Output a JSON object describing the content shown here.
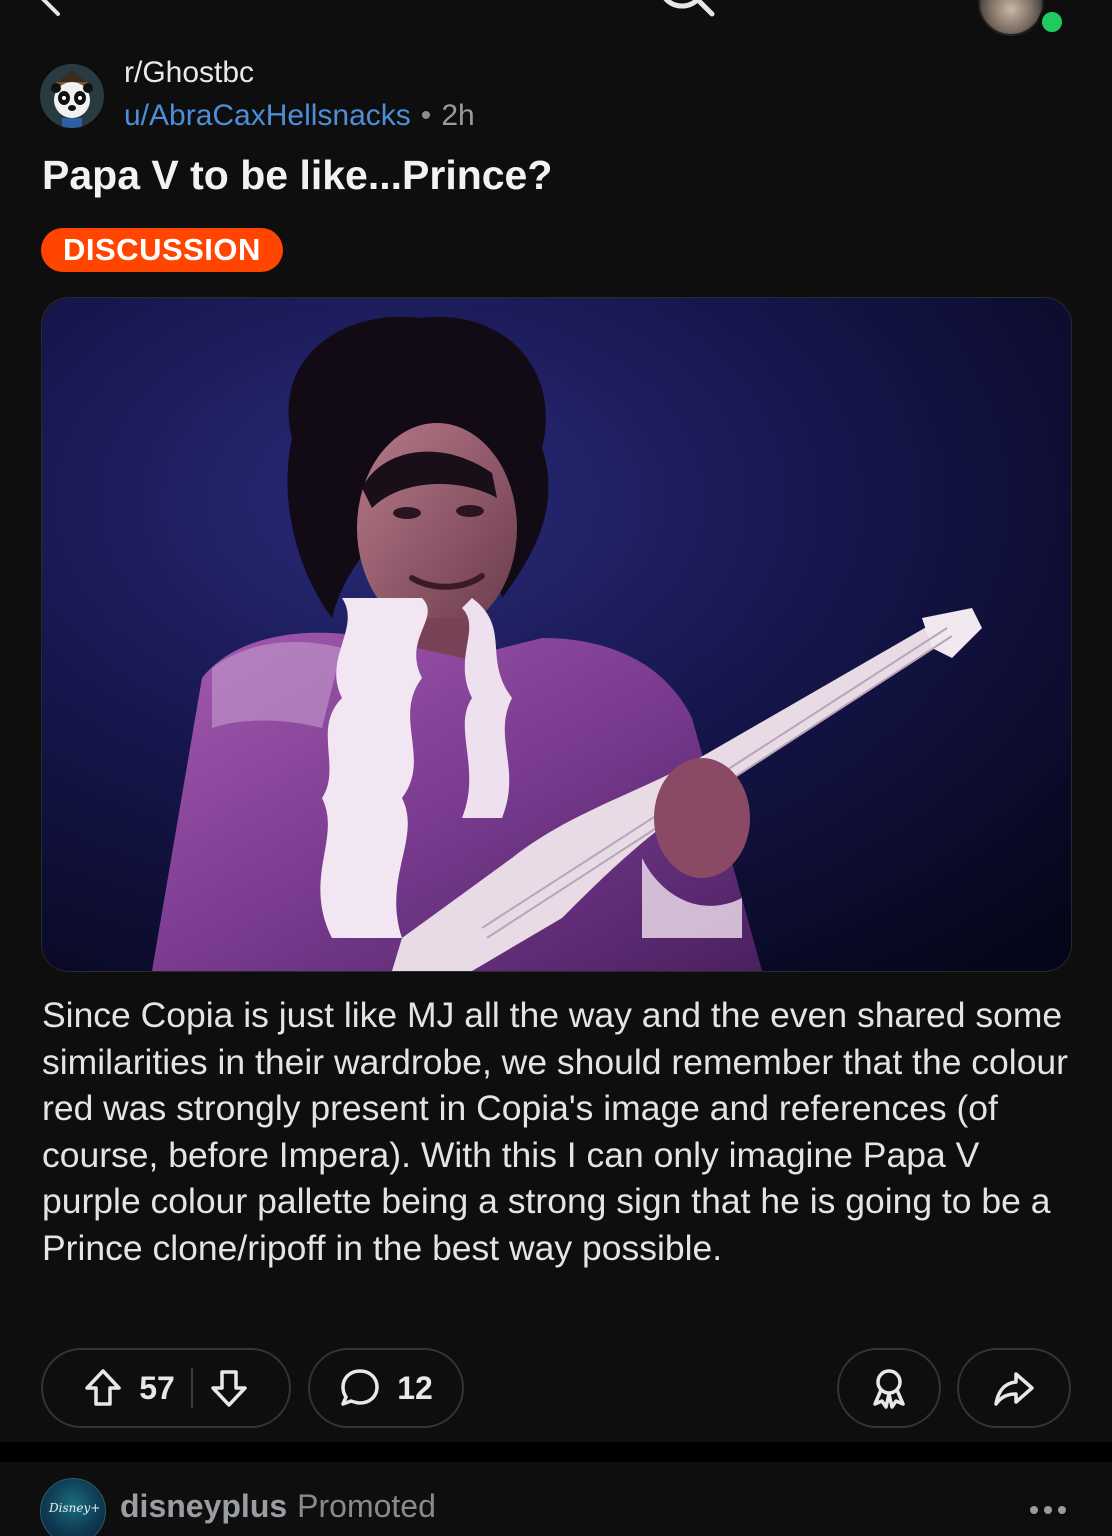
{
  "post": {
    "subreddit": "r/Ghostbc",
    "author": "u/AbraCaxHellsnacks",
    "separator": "•",
    "age": "2h",
    "title": "Papa V to be like...Prince?",
    "flair": "DISCUSSION",
    "body": "Since Copia is just like MJ all the way and the even shared some similarities in their wardrobe, we should remember that the colour red was strongly present in Copia's image and references (of course, before Impera). With this I can only imagine Papa V purple colour pallette being a strong sign that he is going to be a Prince clone/ripoff in the best way possible.",
    "upvotes": "57",
    "comments": "12"
  },
  "promoted": {
    "name": "disneyplus",
    "tag": "Promoted",
    "avatar_text": "Disney+"
  },
  "colors": {
    "flair": "#ff4500",
    "username": "#4c8fd8",
    "online": "#1fcc5f"
  },
  "icons": {
    "back": "chevron-left-icon",
    "search": "search-icon",
    "chat": "chat-icon",
    "upvote": "upvote-arrow-icon",
    "downvote": "downvote-arrow-icon",
    "comment": "comment-bubble-icon",
    "award": "award-icon",
    "share": "share-arrow-icon",
    "more": "more-dots-icon"
  }
}
